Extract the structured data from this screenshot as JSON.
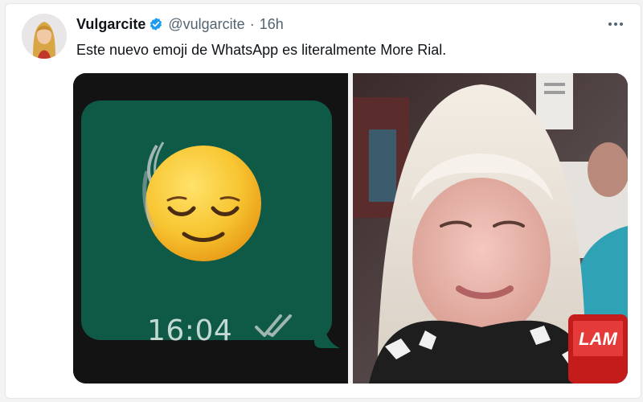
{
  "tweet": {
    "author_name": "Vulgarcite",
    "handle": "@vulgarcite",
    "separator": "·",
    "time": "16h",
    "text": "Este nuevo emoji de WhatsApp es literalmente More Rial."
  },
  "icons": {
    "verified": "verified-badge-icon",
    "more": "more-options-icon",
    "read_receipt": "double-check-icon",
    "emoji": "relieved-face-emoji"
  },
  "media": {
    "left": {
      "bubble_time": "16:04"
    },
    "right": {
      "mic_logo_text": "LAM"
    }
  },
  "colors": {
    "verified_blue": "#1d9bf0",
    "whatsapp_bubble": "#0f5a46",
    "check_color": "#9fb7b0",
    "secondary_text": "#536471"
  }
}
